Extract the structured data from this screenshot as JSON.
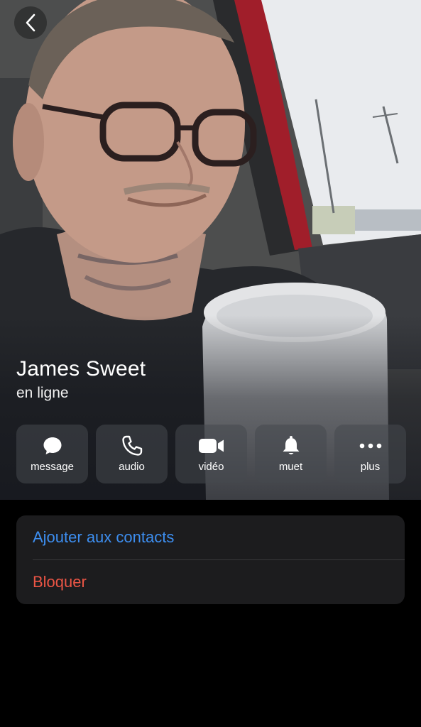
{
  "contact": {
    "name": "James Sweet",
    "status": "en ligne"
  },
  "actions": [
    {
      "label": "message",
      "icon": "message-bubble-icon"
    },
    {
      "label": "audio",
      "icon": "phone-icon"
    },
    {
      "label": "vidéo",
      "icon": "video-camera-icon"
    },
    {
      "label": "muet",
      "icon": "bell-icon"
    },
    {
      "label": "plus",
      "icon": "more-dots-icon"
    }
  ],
  "menu": {
    "add_contact": "Ajouter aux contacts",
    "block": "Bloquer"
  },
  "colors": {
    "link_blue": "#3d8ef0",
    "destructive_red": "#eb5545",
    "card_bg": "#1c1c1e",
    "page_bg": "#000000"
  }
}
